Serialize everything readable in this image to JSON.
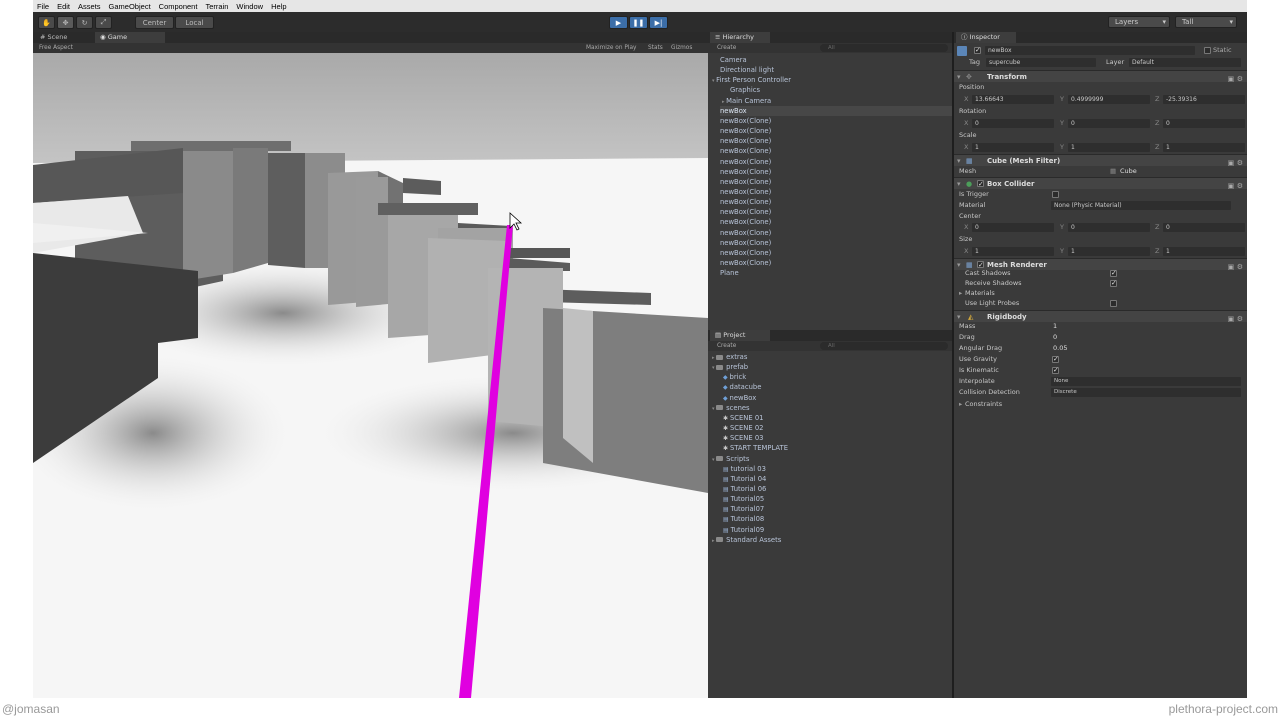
{
  "menu": [
    "File",
    "Edit",
    "Assets",
    "GameObject",
    "Component",
    "Terrain",
    "Window",
    "Help"
  ],
  "toolbar": {
    "pivot_center": "Center",
    "pivot_local": "Local",
    "layers": "Layers",
    "layout": "Tall"
  },
  "scene_panel": {
    "tabs": [
      "Scene",
      "Game"
    ],
    "aspect": "Free Aspect",
    "maximize": "Maximize on Play",
    "stats": "Stats",
    "gizmos": "Gizmos"
  },
  "hierarchy": {
    "tab": "Hierarchy",
    "create": "Create",
    "search": "All",
    "items": [
      "Camera",
      "Directional light",
      "First Person Controller",
      "Graphics",
      "Main Camera",
      "newBox",
      "newBox(Clone)",
      "newBox(Clone)",
      "newBox(Clone)",
      "newBox(Clone)",
      "newBox(Clone)",
      "newBox(Clone)",
      "newBox(Clone)",
      "newBox(Clone)",
      "newBox(Clone)",
      "newBox(Clone)",
      "newBox(Clone)",
      "newBox(Clone)",
      "newBox(Clone)",
      "newBox(Clone)",
      "newBox(Clone)",
      "Plane"
    ]
  },
  "project": {
    "tab": "Project",
    "create": "Create",
    "search": "All",
    "items": [
      "extras",
      "prefab",
      "brick",
      "datacube",
      "newBox",
      "scenes",
      "SCENE 01",
      "SCENE 02",
      "SCENE 03",
      "START TEMPLATE",
      "Scripts",
      "tutorial 03",
      "Tutorial 04",
      "Tutorial 06",
      "Tutorial05",
      "Tutorial07",
      "Tutorial08",
      "Tutorial09",
      "Standard Assets"
    ]
  },
  "inspector": {
    "tab": "Inspector",
    "object_name": "newBox",
    "static": "Static",
    "tag_label": "Tag",
    "tag": "supercube",
    "layer_label": "Layer",
    "layer": "Default",
    "transform": {
      "title": "Transform",
      "position": "Position",
      "pos_x": "13.66643",
      "pos_y": "0.4999999",
      "pos_z": "-25.39316",
      "rotation": "Rotation",
      "rot_x": "0",
      "rot_y": "0",
      "rot_z": "0",
      "scale": "Scale",
      "sc_x": "1",
      "sc_y": "1",
      "sc_z": "1"
    },
    "mesh_filter": {
      "title": "Cube (Mesh Filter)",
      "mesh_label": "Mesh",
      "mesh": "Cube"
    },
    "box_collider": {
      "title": "Box Collider",
      "is_trigger": "Is Trigger",
      "material_label": "Material",
      "material": "None (Physic Material)",
      "center": "Center",
      "c_x": "0",
      "c_y": "0",
      "c_z": "0",
      "size": "Size",
      "s_x": "1",
      "s_y": "1",
      "s_z": "1"
    },
    "mesh_renderer": {
      "title": "Mesh Renderer",
      "cast_shadows": "Cast Shadows",
      "receive_shadows": "Receive Shadows",
      "materials": "Materials",
      "light_probes": "Use Light Probes"
    },
    "rigidbody": {
      "title": "Rigidbody",
      "mass_label": "Mass",
      "mass": "1",
      "drag_label": "Drag",
      "drag": "0",
      "angular_label": "Angular Drag",
      "angular": "0.05",
      "gravity": "Use Gravity",
      "kinematic": "Is Kinematic",
      "interpolate_label": "Interpolate",
      "interpolate": "None",
      "collision_label": "Collision Detection",
      "collision": "Discrete",
      "constraints": "Constraints"
    }
  },
  "footer": {
    "left": "@jomasan",
    "right": "plethora-project.com"
  },
  "colors": {
    "laser": "#e000e0",
    "play_blue": "#3c6ea8"
  }
}
